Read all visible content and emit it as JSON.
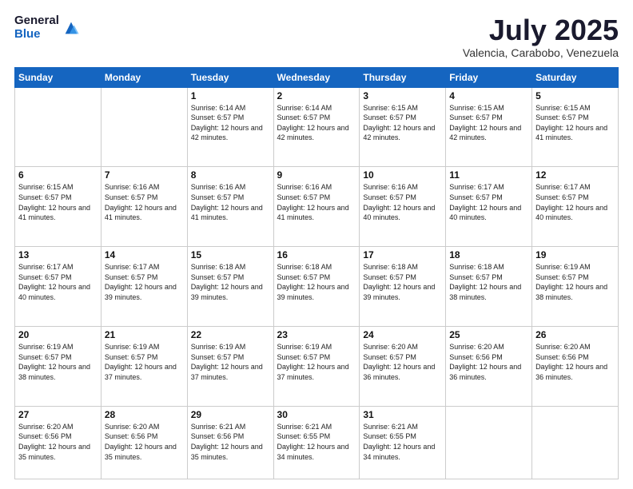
{
  "header": {
    "logo_general": "General",
    "logo_blue": "Blue",
    "month": "July 2025",
    "location": "Valencia, Carabobo, Venezuela"
  },
  "days_of_week": [
    "Sunday",
    "Monday",
    "Tuesday",
    "Wednesday",
    "Thursday",
    "Friday",
    "Saturday"
  ],
  "weeks": [
    [
      {
        "day": "",
        "info": ""
      },
      {
        "day": "",
        "info": ""
      },
      {
        "day": "1",
        "info": "Sunrise: 6:14 AM\nSunset: 6:57 PM\nDaylight: 12 hours and 42 minutes."
      },
      {
        "day": "2",
        "info": "Sunrise: 6:14 AM\nSunset: 6:57 PM\nDaylight: 12 hours and 42 minutes."
      },
      {
        "day": "3",
        "info": "Sunrise: 6:15 AM\nSunset: 6:57 PM\nDaylight: 12 hours and 42 minutes."
      },
      {
        "day": "4",
        "info": "Sunrise: 6:15 AM\nSunset: 6:57 PM\nDaylight: 12 hours and 42 minutes."
      },
      {
        "day": "5",
        "info": "Sunrise: 6:15 AM\nSunset: 6:57 PM\nDaylight: 12 hours and 41 minutes."
      }
    ],
    [
      {
        "day": "6",
        "info": "Sunrise: 6:15 AM\nSunset: 6:57 PM\nDaylight: 12 hours and 41 minutes."
      },
      {
        "day": "7",
        "info": "Sunrise: 6:16 AM\nSunset: 6:57 PM\nDaylight: 12 hours and 41 minutes."
      },
      {
        "day": "8",
        "info": "Sunrise: 6:16 AM\nSunset: 6:57 PM\nDaylight: 12 hours and 41 minutes."
      },
      {
        "day": "9",
        "info": "Sunrise: 6:16 AM\nSunset: 6:57 PM\nDaylight: 12 hours and 41 minutes."
      },
      {
        "day": "10",
        "info": "Sunrise: 6:16 AM\nSunset: 6:57 PM\nDaylight: 12 hours and 40 minutes."
      },
      {
        "day": "11",
        "info": "Sunrise: 6:17 AM\nSunset: 6:57 PM\nDaylight: 12 hours and 40 minutes."
      },
      {
        "day": "12",
        "info": "Sunrise: 6:17 AM\nSunset: 6:57 PM\nDaylight: 12 hours and 40 minutes."
      }
    ],
    [
      {
        "day": "13",
        "info": "Sunrise: 6:17 AM\nSunset: 6:57 PM\nDaylight: 12 hours and 40 minutes."
      },
      {
        "day": "14",
        "info": "Sunrise: 6:17 AM\nSunset: 6:57 PM\nDaylight: 12 hours and 39 minutes."
      },
      {
        "day": "15",
        "info": "Sunrise: 6:18 AM\nSunset: 6:57 PM\nDaylight: 12 hours and 39 minutes."
      },
      {
        "day": "16",
        "info": "Sunrise: 6:18 AM\nSunset: 6:57 PM\nDaylight: 12 hours and 39 minutes."
      },
      {
        "day": "17",
        "info": "Sunrise: 6:18 AM\nSunset: 6:57 PM\nDaylight: 12 hours and 39 minutes."
      },
      {
        "day": "18",
        "info": "Sunrise: 6:18 AM\nSunset: 6:57 PM\nDaylight: 12 hours and 38 minutes."
      },
      {
        "day": "19",
        "info": "Sunrise: 6:19 AM\nSunset: 6:57 PM\nDaylight: 12 hours and 38 minutes."
      }
    ],
    [
      {
        "day": "20",
        "info": "Sunrise: 6:19 AM\nSunset: 6:57 PM\nDaylight: 12 hours and 38 minutes."
      },
      {
        "day": "21",
        "info": "Sunrise: 6:19 AM\nSunset: 6:57 PM\nDaylight: 12 hours and 37 minutes."
      },
      {
        "day": "22",
        "info": "Sunrise: 6:19 AM\nSunset: 6:57 PM\nDaylight: 12 hours and 37 minutes."
      },
      {
        "day": "23",
        "info": "Sunrise: 6:19 AM\nSunset: 6:57 PM\nDaylight: 12 hours and 37 minutes."
      },
      {
        "day": "24",
        "info": "Sunrise: 6:20 AM\nSunset: 6:57 PM\nDaylight: 12 hours and 36 minutes."
      },
      {
        "day": "25",
        "info": "Sunrise: 6:20 AM\nSunset: 6:56 PM\nDaylight: 12 hours and 36 minutes."
      },
      {
        "day": "26",
        "info": "Sunrise: 6:20 AM\nSunset: 6:56 PM\nDaylight: 12 hours and 36 minutes."
      }
    ],
    [
      {
        "day": "27",
        "info": "Sunrise: 6:20 AM\nSunset: 6:56 PM\nDaylight: 12 hours and 35 minutes."
      },
      {
        "day": "28",
        "info": "Sunrise: 6:20 AM\nSunset: 6:56 PM\nDaylight: 12 hours and 35 minutes."
      },
      {
        "day": "29",
        "info": "Sunrise: 6:21 AM\nSunset: 6:56 PM\nDaylight: 12 hours and 35 minutes."
      },
      {
        "day": "30",
        "info": "Sunrise: 6:21 AM\nSunset: 6:55 PM\nDaylight: 12 hours and 34 minutes."
      },
      {
        "day": "31",
        "info": "Sunrise: 6:21 AM\nSunset: 6:55 PM\nDaylight: 12 hours and 34 minutes."
      },
      {
        "day": "",
        "info": ""
      },
      {
        "day": "",
        "info": ""
      }
    ]
  ]
}
